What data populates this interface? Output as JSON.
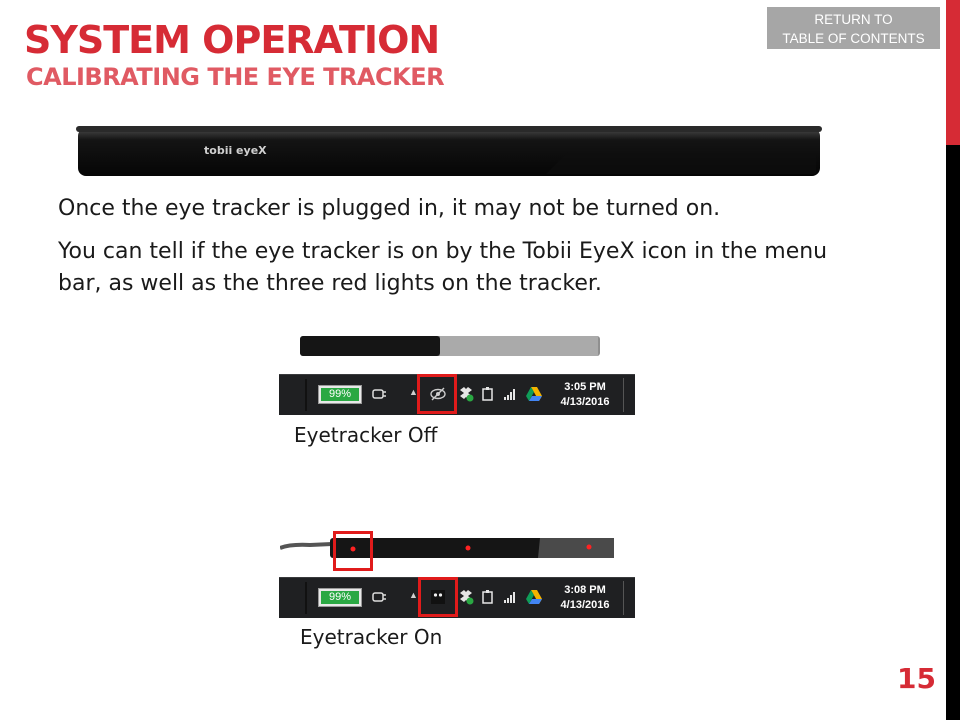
{
  "header": {
    "title": "SYSTEM OPERATION",
    "subtitle": "CALIBRATING THE EYE TRACKER"
  },
  "return_button": {
    "line1": "RETURN TO",
    "line2": "TABLE OF CONTENTS"
  },
  "device_brand": "tobii eyeX",
  "body": {
    "para1": "Once the eye tracker is plugged in, it may not be turned on.",
    "para2": "You can tell if the eye tracker is on by the Tobii EyeX icon in the menu bar, as well as the three red lights on the tracker."
  },
  "figure_off": {
    "battery": "99%",
    "time": "3:05 PM",
    "date": "4/13/2016",
    "caption": "Eyetracker Off"
  },
  "figure_on": {
    "battery": "99%",
    "time": "3:08 PM",
    "date": "4/13/2016",
    "caption": "Eyetracker On"
  },
  "page_number": "15",
  "colors": {
    "accent_red": "#d62b35",
    "battery_green": "#2aa843",
    "taskbar": "#1f2022"
  }
}
